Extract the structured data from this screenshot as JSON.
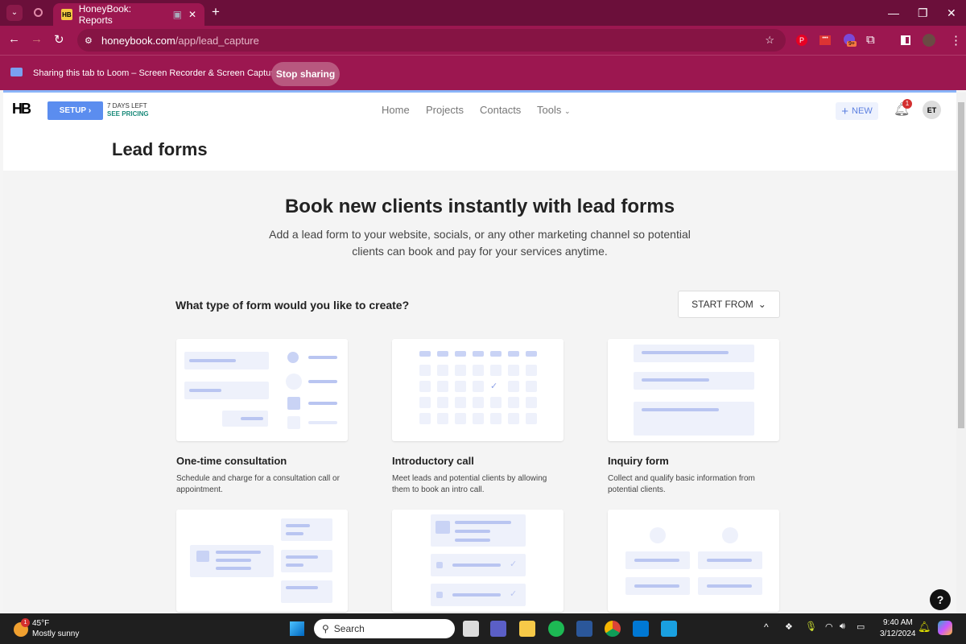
{
  "browser": {
    "tab_title": "HoneyBook: Reports",
    "url_host": "honeybook.com",
    "url_path": "/app/lead_capture",
    "share_text": "Sharing this tab to Loom – Screen Recorder & Screen Capture",
    "stop_sharing": "Stop sharing",
    "ext_badge": "9+"
  },
  "header": {
    "logo": "HB",
    "setup": "SETUP",
    "days_left": "7 DAYS LEFT",
    "see_pricing": "SEE PRICING",
    "nav": [
      "Home",
      "Projects",
      "Contacts",
      "Tools"
    ],
    "new": "NEW",
    "notif_count": "1",
    "avatar": "ET",
    "page_title": "Lead forms"
  },
  "hero": {
    "title": "Book new clients instantly with lead forms",
    "subtitle1": "Add a lead form to your website, socials, or any other marketing channel so potential",
    "subtitle2": "clients can book and pay for your services anytime."
  },
  "question": "What type of form would you like to create?",
  "start_from": "START FROM",
  "cards": [
    {
      "title": "One-time consultation",
      "desc": "Schedule and charge for a consultation call or appointment."
    },
    {
      "title": "Introductory call",
      "desc": "Meet leads and potential clients by allowing them to book an intro call."
    },
    {
      "title": "Inquiry form",
      "desc": "Collect and qualify basic information from potential clients."
    }
  ],
  "help": "?",
  "taskbar": {
    "temp": "45°F",
    "weather": "Mostly sunny",
    "weather_badge": "1",
    "search": "Search",
    "time": "9:40 AM",
    "date": "3/12/2024"
  }
}
